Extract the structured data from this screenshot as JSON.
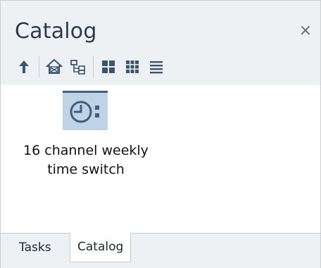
{
  "panel": {
    "title": "Catalog",
    "close_label": "×"
  },
  "toolbar": {
    "items": [
      {
        "name": "up",
        "icon": "up-arrow-icon"
      },
      {
        "name": "home",
        "icon": "home-icon"
      },
      {
        "name": "tree",
        "icon": "tree-view-icon"
      },
      {
        "name": "large-icons",
        "icon": "large-icons-view-icon",
        "active": true
      },
      {
        "name": "small-icons",
        "icon": "small-icons-view-icon"
      },
      {
        "name": "list",
        "icon": "list-view-icon"
      }
    ]
  },
  "catalog": {
    "items": [
      {
        "label_line1": "16 channel weekly",
        "label_line2": "time switch",
        "icon": "time-switch-icon"
      }
    ]
  },
  "tabs": [
    {
      "label": "Tasks"
    },
    {
      "label": "Catalog",
      "selected": true
    }
  ],
  "colors": {
    "accent": "#3e5f7d",
    "tile_bg": "#bfd3e6",
    "panel_bg": "#eef1f4"
  }
}
